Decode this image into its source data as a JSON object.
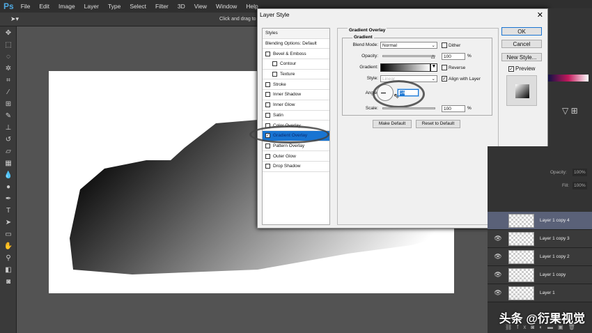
{
  "menubar": {
    "logo": "Ps",
    "items": [
      "File",
      "Edit",
      "Image",
      "Layer",
      "Type",
      "Select",
      "Filter",
      "3D",
      "View",
      "Window",
      "Help"
    ]
  },
  "optbar": {
    "hint": "Click and drag to"
  },
  "dialog": {
    "title": "Layer Style",
    "styles_header": "Styles",
    "blending": "Blending Options: Default",
    "items": [
      {
        "label": "Bevel & Emboss",
        "checked": false,
        "sub": false
      },
      {
        "label": "Contour",
        "checked": false,
        "sub": true
      },
      {
        "label": "Texture",
        "checked": false,
        "sub": true
      },
      {
        "label": "Stroke",
        "checked": false,
        "sub": false
      },
      {
        "label": "Inner Shadow",
        "checked": false,
        "sub": false
      },
      {
        "label": "Inner Glow",
        "checked": false,
        "sub": false
      },
      {
        "label": "Satin",
        "checked": false,
        "sub": false
      },
      {
        "label": "Color Overlay",
        "checked": false,
        "sub": false
      },
      {
        "label": "Gradient Overlay",
        "checked": true,
        "sub": false,
        "selected": true
      },
      {
        "label": "Pattern Overlay",
        "checked": false,
        "sub": false
      },
      {
        "label": "Outer Glow",
        "checked": false,
        "sub": false
      },
      {
        "label": "Drop Shadow",
        "checked": false,
        "sub": false
      }
    ],
    "section": "Gradient Overlay",
    "group": "Gradient",
    "blend_mode_label": "Blend Mode:",
    "blend_mode": "Normal",
    "dither": "Dither",
    "opacity_label": "Opacity:",
    "opacity": "100",
    "pct": "%",
    "gradient_label": "Gradient:",
    "reverse": "Reverse",
    "style_label": "Style:",
    "style": "Linear",
    "align": "Align with Layer",
    "angle_label": "Angle:",
    "angle": "16",
    "scale_label": "Scale:",
    "scale": "100",
    "make_default": "Make Default",
    "reset_default": "Reset to Default",
    "ok": "OK",
    "cancel": "Cancel",
    "new_style": "New Style...",
    "preview": "Preview"
  },
  "layers": {
    "opacity_label": "Opacity:",
    "opacity": "100%",
    "fill_label": "Fill:",
    "fill": "100%",
    "rows": [
      "Layer 1 copy 4",
      "Layer 1 copy 3",
      "Layer 1 copy 2",
      "Layer 1 copy",
      "Layer 1"
    ]
  },
  "watermark": "头条 @衍果视觉"
}
